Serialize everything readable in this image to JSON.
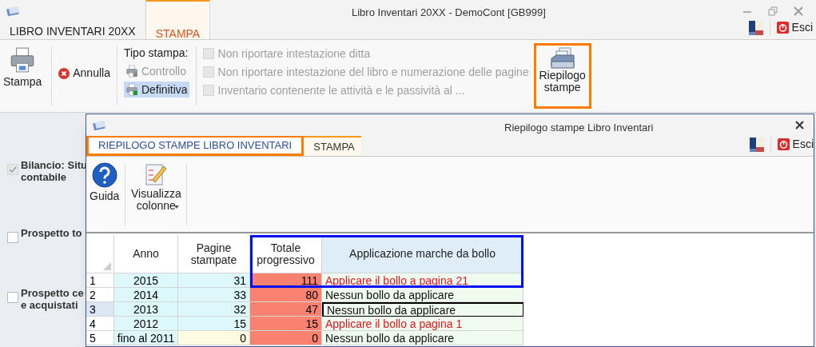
{
  "window": {
    "title": "Libro Inventari 20XX - DemoCont [GB999]"
  },
  "tabs": [
    {
      "label": "LIBRO INVENTARI 20XX",
      "selected": false
    },
    {
      "label": "STAMPA",
      "selected": true
    }
  ],
  "exit_button": "Esci",
  "ribbon": {
    "print_button": "Stampa",
    "cancel_button": "Annulla",
    "print_type_label": "Tipo stampa:",
    "print_types": [
      {
        "label": "Controllo",
        "selected": false,
        "disabled": true
      },
      {
        "label": "Definitiva",
        "selected": true,
        "disabled": false
      }
    ],
    "options": [
      {
        "label": "Non riportare intestazione ditta",
        "checked": false,
        "disabled": true
      },
      {
        "label": "Non riportare intestazione del libro e numerazione delle pagine",
        "checked": false,
        "disabled": true
      },
      {
        "label": "Inventario contenente le attività e le passività al ...",
        "checked": false,
        "disabled": true
      }
    ],
    "summary_button": {
      "label": "Riepilogo stampe",
      "highlighted": true
    }
  },
  "sections": [
    {
      "lines": [
        "Bilancio: Situ",
        "contabile"
      ],
      "checked": true
    },
    {
      "lines": [
        "Prospetto to"
      ],
      "checked": false
    },
    {
      "lines": [
        "Prospetto ce",
        "e acquistati"
      ],
      "checked": false
    }
  ],
  "dialog": {
    "title": "Riepilogo stampe Libro Inventari",
    "exit_button": "Esci",
    "tabs": [
      {
        "label": "RIEPILOGO STAMPE LIBRO INVENTARI",
        "selected": true,
        "highlighted": true
      },
      {
        "label": "STAMPA",
        "selected": false,
        "highlighted": false
      }
    ],
    "ribbon": {
      "help_button": "Guida",
      "columns_button": "Visualizza colonne"
    },
    "table": {
      "columns": [
        "Anno",
        "Pagine stampate",
        "Totale progressivo",
        "Applicazione marche da bollo"
      ],
      "annotation_box": true,
      "rows": [
        {
          "number": "1",
          "selected": false,
          "year": "2015",
          "pages": {
            "text": "31",
            "color": "#dcf8fa"
          },
          "total": "111",
          "stamp": {
            "text": "Applicare il bollo a pagina  21",
            "kind": "apply"
          }
        },
        {
          "number": "2",
          "selected": false,
          "year": "2014",
          "pages": {
            "text": "33",
            "color": "#dcf8fa"
          },
          "total": "80",
          "stamp": {
            "text": "Nessun bollo da applicare",
            "kind": "none"
          }
        },
        {
          "number": "3",
          "selected": true,
          "year": "2013",
          "pages": {
            "text": "32",
            "color": "#dcf8fa"
          },
          "total": "47",
          "stamp": {
            "text": "Nessun bollo da applicare",
            "kind": "none"
          }
        },
        {
          "number": "4",
          "selected": false,
          "year": "2012",
          "pages": {
            "text": "15",
            "color": "#dcf8fa"
          },
          "total": "15",
          "stamp": {
            "text": "Applicare il bollo a pagina  1",
            "kind": "apply"
          }
        },
        {
          "number": "5",
          "selected": false,
          "year": "fino al 2011",
          "pages": {
            "text": "0",
            "color": "#fffbe3"
          },
          "total": "0",
          "stamp": {
            "text": "Nessun bollo da applicare",
            "kind": "none"
          }
        }
      ]
    }
  }
}
